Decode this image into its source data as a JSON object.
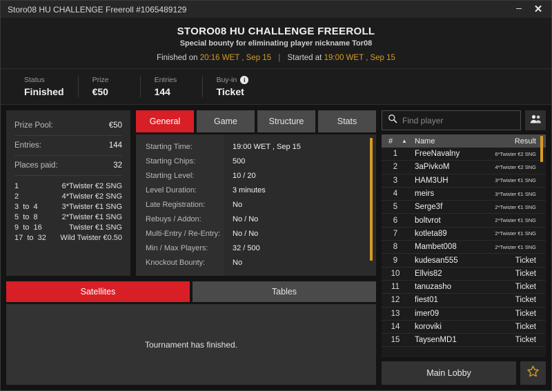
{
  "window": {
    "title": "Storo08 HU CHALLENGE Freeroll #1065489129",
    "minimize_label": "–",
    "close_label": "✕"
  },
  "header": {
    "title": "STORO08 HU CHALLENGE FREEROLL",
    "subtitle": "Special bounty for eliminating player nickname Tor08",
    "finished_prefix": "Finished on",
    "finished_value": "20:16 WET , Sep 15",
    "divider": "|",
    "started_prefix": "Started at",
    "started_value": "19:00 WET , Sep 15"
  },
  "status_strip": [
    {
      "label": "Status",
      "value": "Finished",
      "info": false
    },
    {
      "label": "Prize",
      "value": "€50",
      "info": false
    },
    {
      "label": "Entries",
      "value": "144",
      "info": false
    },
    {
      "label": "Buy-in",
      "value": "Ticket",
      "info": true,
      "info_glyph": "i"
    }
  ],
  "prize_panel": {
    "rows": [
      {
        "key": "Prize Pool:",
        "value": "€50"
      },
      {
        "key": "Entries:",
        "value": "144"
      },
      {
        "key": "Places paid:",
        "value": "32"
      }
    ],
    "payouts": [
      {
        "place": "1",
        "prize": "6*Twister €2 SNG"
      },
      {
        "place": "2",
        "prize": "4*Twister €2 SNG"
      },
      {
        "place": "3  to  4",
        "prize": "3*Twister €1 SNG"
      },
      {
        "place": "5  to  8",
        "prize": "2*Twister €1 SNG"
      },
      {
        "place": "9  to  16",
        "prize": "Twister €1 SNG"
      },
      {
        "place": "17  to  32",
        "prize": "Wild Twister €0.50"
      }
    ]
  },
  "detail_tabs": [
    {
      "label": "General",
      "active": true
    },
    {
      "label": "Game",
      "active": false
    },
    {
      "label": "Structure",
      "active": false
    },
    {
      "label": "Stats",
      "active": false
    }
  ],
  "details": [
    {
      "key": "Starting Time:",
      "value": "19:00 WET , Sep 15"
    },
    {
      "key": "Starting Chips:",
      "value": "500"
    },
    {
      "key": "Starting Level:",
      "value": "10 / 20"
    },
    {
      "key": "Level Duration:",
      "value": "3 minutes"
    },
    {
      "key": "Late Registration:",
      "value": "No"
    },
    {
      "key": "Rebuys / Addon:",
      "value": "No / No"
    },
    {
      "key": "Multi-Entry / Re-Entry:",
      "value": "No / No"
    },
    {
      "key": "Min / Max Players:",
      "value": "32 / 500"
    },
    {
      "key": "Knockout Bounty:",
      "value": "No"
    }
  ],
  "bottom_tabs": [
    {
      "label": "Satellites",
      "active": true
    },
    {
      "label": "Tables",
      "active": false
    }
  ],
  "bottom_message": "Tournament has finished.",
  "search": {
    "placeholder": "Find player",
    "value": "",
    "icon": "search-icon",
    "people_icon": "people-icon"
  },
  "player_table": {
    "columns": {
      "num": "#",
      "sort": "▲",
      "name": "Name",
      "result": "Result"
    },
    "rows": [
      {
        "num": "1",
        "name": "FreeNavalny",
        "result": "6*Twister €2 SNG",
        "small": true
      },
      {
        "num": "2",
        "name": "3aPivkoM",
        "result": "4*Twister €2 SNG",
        "small": true
      },
      {
        "num": "3",
        "name": "HAM3UH",
        "result": "3*Twister €1 SNG",
        "small": true
      },
      {
        "num": "4",
        "name": "meirs",
        "result": "3*Twister €1 SNG",
        "small": true
      },
      {
        "num": "5",
        "name": "Serge3f",
        "result": "2*Twister €1 SNG",
        "small": true
      },
      {
        "num": "6",
        "name": "boltvrot",
        "result": "2*Twister €1 SNG",
        "small": true
      },
      {
        "num": "7",
        "name": "kotleta89",
        "result": "2*Twister €1 SNG",
        "small": true
      },
      {
        "num": "8",
        "name": "Mambet008",
        "result": "2*Twister €1 SNG",
        "small": true
      },
      {
        "num": "9",
        "name": "kudesan555",
        "result": "Ticket",
        "small": false
      },
      {
        "num": "10",
        "name": "Ellvis82",
        "result": "Ticket",
        "small": false
      },
      {
        "num": "11",
        "name": "tanuzasho",
        "result": "Ticket",
        "small": false
      },
      {
        "num": "12",
        "name": "fiest01",
        "result": "Ticket",
        "small": false
      },
      {
        "num": "13",
        "name": "imer09",
        "result": "Ticket",
        "small": false
      },
      {
        "num": "14",
        "name": "koroviki",
        "result": "Ticket",
        "small": false
      },
      {
        "num": "15",
        "name": "TaysenMD1",
        "result": "Ticket",
        "small": false
      }
    ]
  },
  "footer": {
    "main_lobby_label": "Main Lobby",
    "star_icon": "star-icon"
  },
  "colors": {
    "accent_red": "#d81f26",
    "accent_gold": "#d79b23",
    "panel": "#2b2b2b",
    "tab_inactive": "#4a4a4a"
  }
}
